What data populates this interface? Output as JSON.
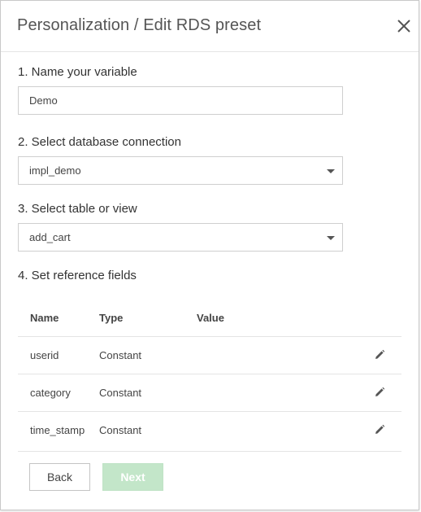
{
  "dialog": {
    "title": "Personalization / Edit RDS preset"
  },
  "steps": {
    "name_label": "1. Name your variable",
    "name_value": "Demo",
    "connection_label": "2. Select database connection",
    "connection_value": "impl_demo",
    "table_label": "3. Select table or view",
    "table_value": "add_cart",
    "fields_label": "4. Set reference fields"
  },
  "fields_table": {
    "headers": [
      "Name",
      "Type",
      "Value"
    ],
    "rows": [
      {
        "name": "userid",
        "type": "Constant",
        "value": ""
      },
      {
        "name": "category",
        "type": "Constant",
        "value": ""
      },
      {
        "name": "time_stamp",
        "type": "Constant",
        "value": ""
      }
    ]
  },
  "buttons": {
    "back": "Back",
    "next": "Next"
  },
  "icons": {
    "close": "close-icon",
    "dropdown": "caret-down-icon",
    "edit": "pencil-icon"
  },
  "colors": {
    "next_disabled_bg": "#c3e6c9",
    "text": "#333333",
    "border": "#cfcfcf"
  }
}
